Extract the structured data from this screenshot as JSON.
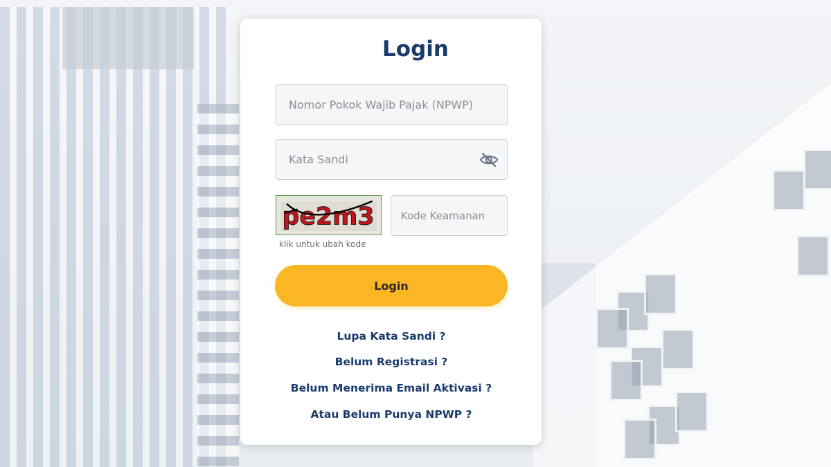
{
  "form": {
    "title": "Login",
    "npwp_placeholder": "Nomor Pokok Wajib Pajak (NPWP)",
    "password_placeholder": "Kata Sandi",
    "captcha_text": "pe2m3",
    "captcha_hint": "klik untuk ubah kode",
    "code_placeholder": "Kode Keamanan",
    "login_button": "Login"
  },
  "links": {
    "forgot_password": "Lupa Kata Sandi ?",
    "not_registered": "Belum Registrasi ?",
    "no_activation_email": "Belum Menerima Email Aktivasi ?",
    "no_npwp": "Atau Belum Punya NPWP ?"
  },
  "colors": {
    "title": "#1a3b6b",
    "button": "#fbb623",
    "captcha_text": "#c0161d"
  },
  "icons": {
    "password_toggle": "eye-slash-icon"
  }
}
